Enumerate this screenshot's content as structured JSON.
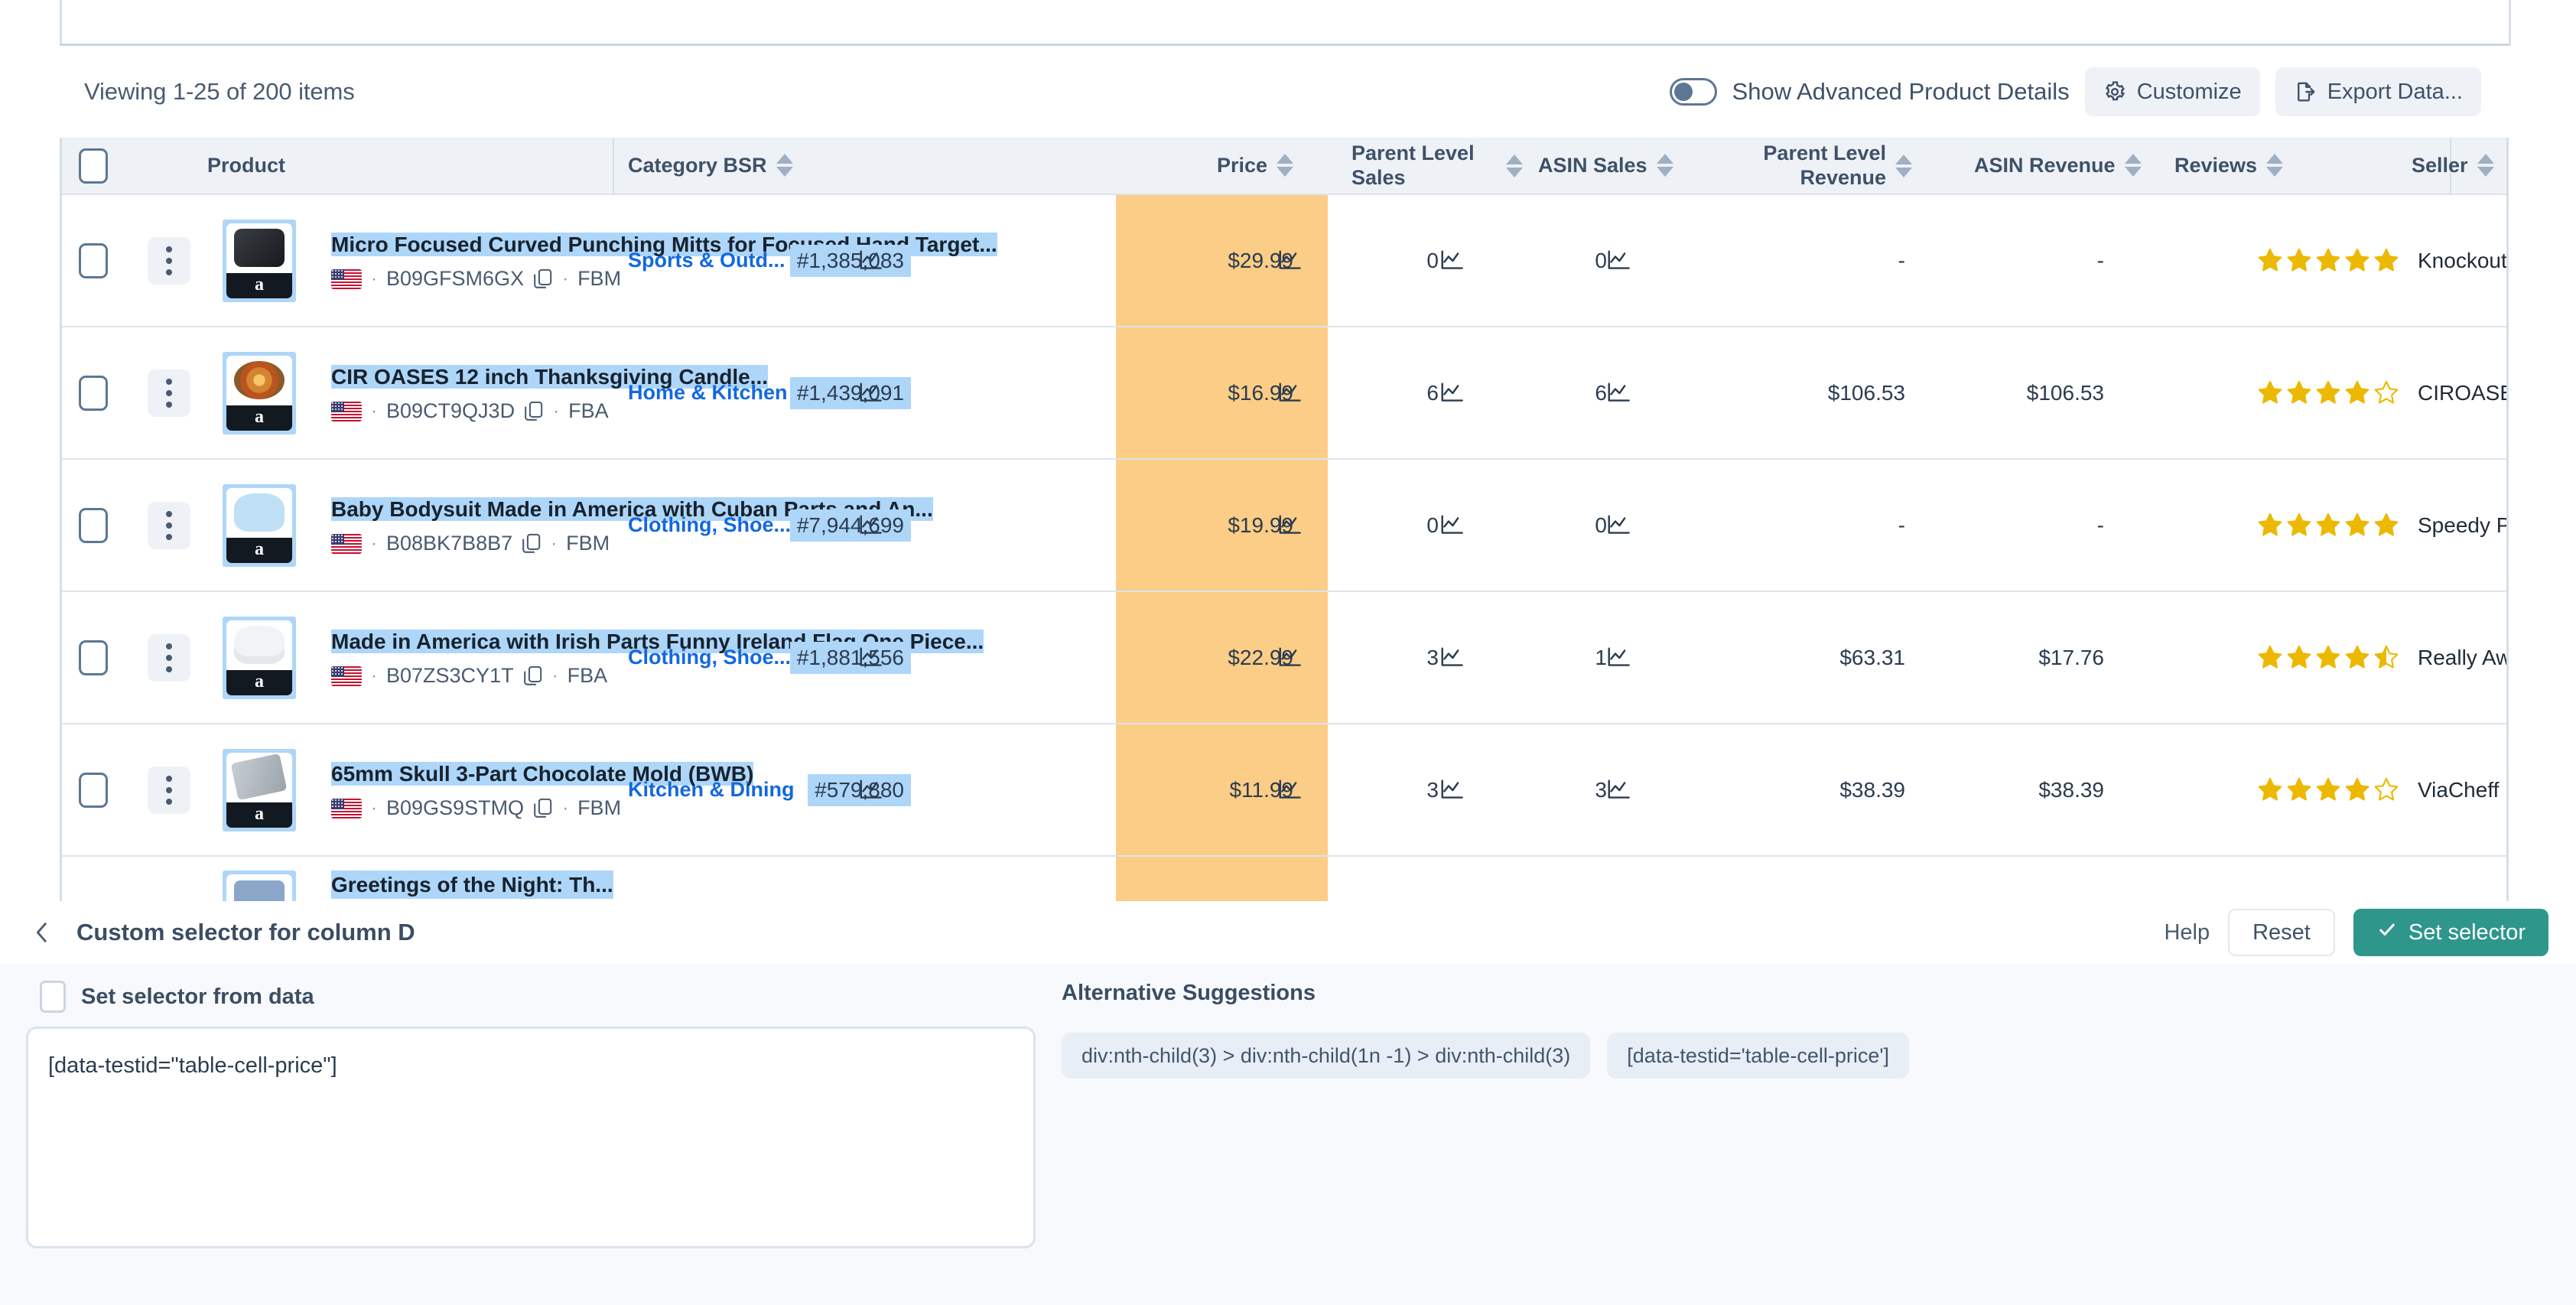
{
  "toolbar": {
    "viewing_text": "Viewing 1-25 of 200 items",
    "toggle_label": "Show Advanced Product Details",
    "toggle_state": "off",
    "customize_label": "Customize",
    "export_label": "Export Data...",
    "gear_icon": "gear-icon",
    "export_icon": "file-export-icon"
  },
  "table": {
    "columns": [
      {
        "label": "Product",
        "sortable": false
      },
      {
        "label": "Category BSR",
        "sortable": true
      },
      {
        "label": "Price",
        "sortable": true,
        "highlighted": true
      },
      {
        "label": "Parent Level Sales",
        "sortable": true
      },
      {
        "label": "ASIN Sales",
        "sortable": true
      },
      {
        "label": "Parent Level Revenue",
        "sortable": true
      },
      {
        "label": "ASIN Revenue",
        "sortable": true
      },
      {
        "label": "Reviews",
        "sortable": true
      },
      {
        "label": "Seller",
        "sortable": true
      }
    ],
    "rows": [
      {
        "title": "Micro Focused Curved Punching Mitts for Focused Hand Target...",
        "marketplace_flag": "us-flag-icon",
        "asin": "B09GFSM6GX",
        "fulfillment": "FBM",
        "category": "Sports & Outd...",
        "bsr": "#1,385,083",
        "price": "$29.99",
        "parent_level_sales": "0",
        "asin_sales": "0",
        "parent_level_revenue": "-",
        "asin_revenue": "-",
        "rating": 5,
        "seller": "Knockout fight"
      },
      {
        "title": "CIR OASES 12 inch Thanksgiving Candle...",
        "marketplace_flag": "us-flag-icon",
        "asin": "B09CT9QJ3D",
        "fulfillment": "FBA",
        "category": "Home & Kitchen",
        "bsr": "#1,439,091",
        "price": "$16.99",
        "parent_level_sales": "6",
        "asin_sales": "6",
        "parent_level_revenue": "$106.53",
        "asin_revenue": "$106.53",
        "rating": 4,
        "seller": "CIROASES"
      },
      {
        "title": "Baby Bodysuit Made in America with Cuban Parts and An...",
        "marketplace_flag": "us-flag-icon",
        "asin": "B08BK7B8B7",
        "fulfillment": "FBM",
        "category": "Clothing, Shoe...",
        "bsr": "#7,944,699",
        "price": "$19.99",
        "parent_level_sales": "0",
        "asin_sales": "0",
        "parent_level_revenue": "-",
        "asin_revenue": "-",
        "rating": 5,
        "seller": "Speedy Pros"
      },
      {
        "title": "Made in America with Irish Parts Funny Ireland Flag One Piece...",
        "marketplace_flag": "us-flag-icon",
        "asin": "B07ZS3CY1T",
        "fulfillment": "FBA",
        "category": "Clothing, Shoe...",
        "bsr": "#1,881,556",
        "price": "$22.99",
        "parent_level_sales": "3",
        "asin_sales": "1",
        "parent_level_revenue": "$63.31",
        "asin_revenue": "$17.76",
        "rating": 4.5,
        "seller": "Really Awesom"
      },
      {
        "title": "65mm Skull 3-Part Chocolate Mold (BWB)",
        "marketplace_flag": "us-flag-icon",
        "asin": "B09GS9STMQ",
        "fulfillment": "FBM",
        "category": "Kitchen & Dining",
        "bsr": "#579,880",
        "price": "$11.99",
        "parent_level_sales": "3",
        "asin_sales": "3",
        "parent_level_revenue": "$38.39",
        "asin_revenue": "$38.39",
        "rating": 4,
        "seller": "ViaCheff USA"
      }
    ],
    "partial_row": {
      "title": "Greetings of the Night: Th..."
    }
  },
  "panel": {
    "title": "Custom selector for column D",
    "back_icon": "chevron-left-icon",
    "help_label": "Help",
    "reset_label": "Reset",
    "set_selector_label": "Set selector",
    "set_selector_icon": "check-icon",
    "checkbox_label": "Set selector from data",
    "checkbox_checked": false,
    "selector_value": "[data-testid=\"table-cell-price\"]",
    "alternatives_title": "Alternative Suggestions",
    "alternatives": [
      "div:nth-child(3) > div:nth-child(1n -1) > div:nth-child(3)",
      "[data-testid='table-cell-price']"
    ]
  },
  "colors": {
    "accent_teal": "#2f968b",
    "highlight_blue": "#aed6f9",
    "price_orange": "#fbcd86",
    "link_blue": "#1368e0",
    "star_gold": "#ecb800"
  }
}
